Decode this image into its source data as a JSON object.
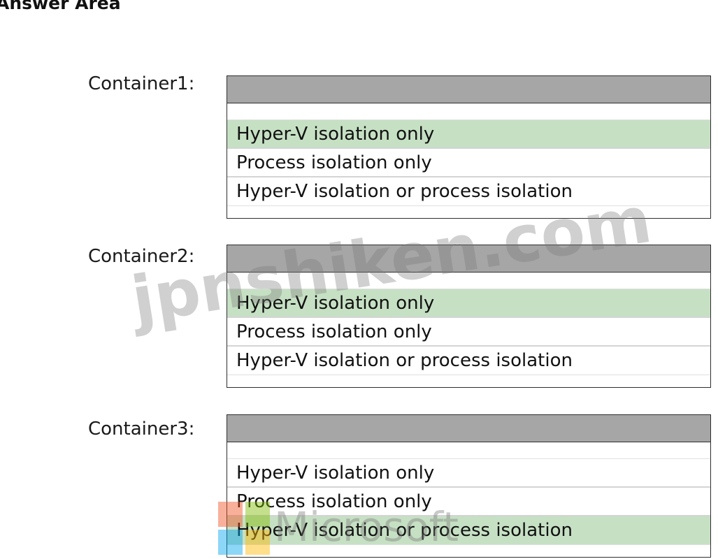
{
  "answer_area": {
    "title": "Answer Area"
  },
  "groups": [
    {
      "label": "Container1:",
      "options": [
        "Hyper-V isolation only",
        "Process isolation only",
        "Hyper-V isolation or process isolation"
      ],
      "selected_option": "Hyper-V isolation only"
    },
    {
      "label": "Container2:",
      "options": [
        "Hyper-V isolation only",
        "Process isolation only",
        "Hyper-V isolation or process isolation"
      ],
      "selected_option": "Hyper-V isolation only"
    },
    {
      "label": "Container3:",
      "options": [
        "Hyper-V isolation only",
        "Process isolation only",
        "Hyper-V isolation or process isolation"
      ],
      "selected_option": "Hyper-V isolation or process isolation"
    }
  ],
  "colors": {
    "header_bar": "#a6a6a6",
    "selected_highlight": "#c6e0c4",
    "border": "#2e2e2e"
  },
  "watermarks": {
    "site": "jpnshiken.com",
    "brand": "Microsoft"
  }
}
